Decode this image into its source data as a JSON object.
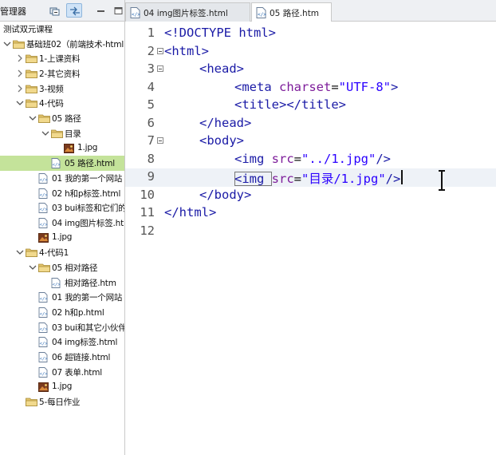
{
  "explorer": {
    "title": "管理器",
    "tree": [
      {
        "label": "测试双元课程",
        "depth": 0,
        "kind": "plain",
        "arrow": "none"
      },
      {
        "label": "基础班02（前端技术-html",
        "depth": 0,
        "kind": "folder",
        "arrow": "down"
      },
      {
        "label": "1-上课资料",
        "depth": 1,
        "kind": "folder",
        "arrow": "right"
      },
      {
        "label": "2-其它资料",
        "depth": 1,
        "kind": "folder",
        "arrow": "right"
      },
      {
        "label": "3-视频",
        "depth": 1,
        "kind": "folder",
        "arrow": "right"
      },
      {
        "label": "4-代码",
        "depth": 1,
        "kind": "folder",
        "arrow": "down"
      },
      {
        "label": "05 路径",
        "depth": 2,
        "kind": "folder",
        "arrow": "down"
      },
      {
        "label": "目录",
        "depth": 3,
        "kind": "folder",
        "arrow": "down"
      },
      {
        "label": "1.jpg",
        "depth": 4,
        "kind": "image",
        "arrow": "none"
      },
      {
        "label": "05 路径.html",
        "depth": 3,
        "kind": "file",
        "arrow": "none",
        "selected": true
      },
      {
        "label": "01 我的第一个网站",
        "depth": 2,
        "kind": "file",
        "arrow": "none"
      },
      {
        "label": "02 h和p标签.html",
        "depth": 2,
        "kind": "file",
        "arrow": "none"
      },
      {
        "label": "03 bui标签和它们的",
        "depth": 2,
        "kind": "file",
        "arrow": "none"
      },
      {
        "label": "04 img图片标签.ht",
        "depth": 2,
        "kind": "file",
        "arrow": "none"
      },
      {
        "label": "1.jpg",
        "depth": 2,
        "kind": "image",
        "arrow": "none"
      },
      {
        "label": "4-代码1",
        "depth": 1,
        "kind": "folder",
        "arrow": "down"
      },
      {
        "label": "05 相对路径",
        "depth": 2,
        "kind": "folder",
        "arrow": "down"
      },
      {
        "label": "相对路径.htm",
        "depth": 3,
        "kind": "file",
        "arrow": "none"
      },
      {
        "label": "01 我的第一个网站",
        "depth": 2,
        "kind": "file",
        "arrow": "none"
      },
      {
        "label": "02 h和p.html",
        "depth": 2,
        "kind": "file",
        "arrow": "none"
      },
      {
        "label": "03 bui和其它小伙伴",
        "depth": 2,
        "kind": "file",
        "arrow": "none"
      },
      {
        "label": "04 img标签.html",
        "depth": 2,
        "kind": "file",
        "arrow": "none"
      },
      {
        "label": "06 超链接.html",
        "depth": 2,
        "kind": "file",
        "arrow": "none"
      },
      {
        "label": "07 表单.html",
        "depth": 2,
        "kind": "file",
        "arrow": "none"
      },
      {
        "label": "1.jpg",
        "depth": 2,
        "kind": "image",
        "arrow": "none"
      },
      {
        "label": "5-每日作业",
        "depth": 1,
        "kind": "folder",
        "arrow": "none"
      }
    ]
  },
  "tabs": [
    {
      "label": "04 img图片标签.html",
      "active": false
    },
    {
      "label": "05 路径.htm",
      "active": true
    }
  ],
  "editor": {
    "lines": [
      {
        "n": "1",
        "fold": false,
        "indent": 0,
        "parts": [
          [
            "tag",
            "<!DOCTYPE html>"
          ]
        ]
      },
      {
        "n": "2",
        "fold": true,
        "indent": 0,
        "parts": [
          [
            "tag",
            "<html>"
          ]
        ]
      },
      {
        "n": "3",
        "fold": true,
        "indent": 1,
        "parts": [
          [
            "tag",
            "<head>"
          ]
        ]
      },
      {
        "n": "4",
        "fold": false,
        "indent": 2,
        "parts": [
          [
            "tag",
            "<meta "
          ],
          [
            "attr",
            "charset"
          ],
          [
            "plain",
            "="
          ],
          [
            "str",
            "\"UTF-8\""
          ],
          [
            "tag",
            ">"
          ]
        ]
      },
      {
        "n": "5",
        "fold": false,
        "indent": 2,
        "parts": [
          [
            "tag",
            "<title></title>"
          ]
        ]
      },
      {
        "n": "6",
        "fold": false,
        "indent": 1,
        "parts": [
          [
            "tag",
            "</head>"
          ]
        ]
      },
      {
        "n": "7",
        "fold": true,
        "indent": 1,
        "parts": [
          [
            "tag",
            "<body>"
          ]
        ]
      },
      {
        "n": "8",
        "fold": false,
        "indent": 2,
        "parts": [
          [
            "tag",
            "<img "
          ],
          [
            "attr",
            "src"
          ],
          [
            "plain",
            "="
          ],
          [
            "str",
            "\"../1.jpg\""
          ],
          [
            "tag",
            "/>"
          ]
        ]
      },
      {
        "n": "9",
        "fold": false,
        "indent": 2,
        "highlight": true,
        "parts": [
          [
            "tag",
            "<img "
          ],
          [
            "attr",
            "src"
          ],
          [
            "plain",
            "="
          ],
          [
            "str",
            "\"目录/1.jpg\""
          ],
          [
            "tag",
            "/>"
          ]
        ]
      },
      {
        "n": "10",
        "fold": false,
        "indent": 1,
        "parts": [
          [
            "tag",
            "</body>"
          ]
        ]
      },
      {
        "n": "11",
        "fold": false,
        "indent": 0,
        "parts": [
          [
            "tag",
            "</html>"
          ]
        ]
      },
      {
        "n": "12",
        "fold": false,
        "indent": 0,
        "parts": []
      }
    ]
  },
  "icons": {
    "collapse_all": "collapse-all-icon",
    "link_with_editor": "link-editor-icon",
    "minimize": "minimize-icon",
    "maximize": "maximize-icon",
    "folder": "folder-icon",
    "html_file": "html-file-icon",
    "image_file": "image-file-icon",
    "text_cursor": "ibeam-cursor-icon"
  },
  "colors": {
    "tag": "#1a1aa6",
    "attribute": "#7d1c9a",
    "string": "#2a00ff",
    "selection": "#c4e39a",
    "current_line": "#eef2f7"
  }
}
